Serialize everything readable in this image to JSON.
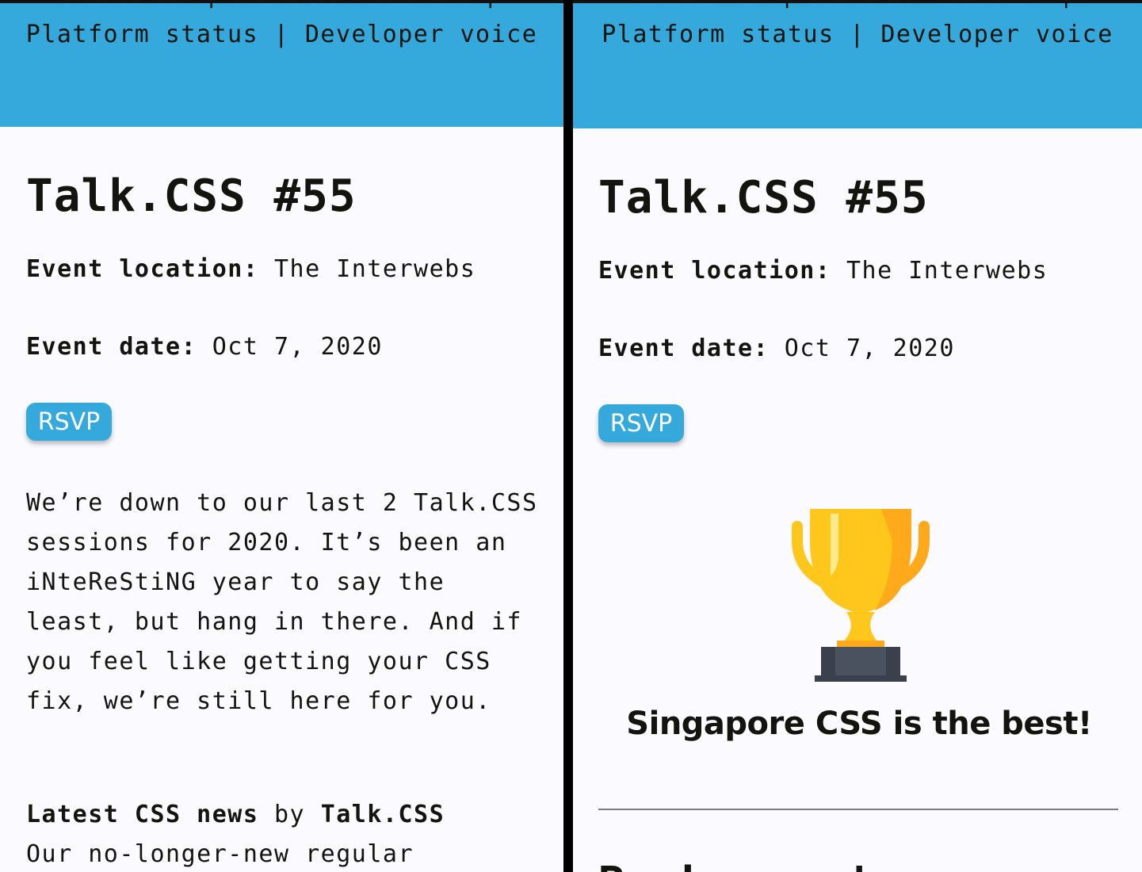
{
  "nav": {
    "top_partial": "About us | Code of conduct |",
    "second_line": "Platform status | Developer voice"
  },
  "event": {
    "title": "Talk.CSS #55",
    "location_label": "Event location:",
    "location_value": "The Interwebs",
    "date_label": "Event date:",
    "date_value": "Oct 7, 2020",
    "rsvp_label": "RSVP"
  },
  "left": {
    "paragraph": "We’re down to our last 2 Talk.CSS sessions for 2020. It’s been an iNteReStiNG year to say the least, but hang in there. And if you feel like getting your CSS fix, we’re still here for you.",
    "news_title": "Latest CSS news",
    "news_by": "by",
    "news_author": "Talk.CSS",
    "news_body": "Our no-longer-new regular"
  },
  "right": {
    "trophy_icon": "trophy-icon",
    "caption": "Singapore CSS is the best!",
    "cut_heading": "Back soon!"
  },
  "colors": {
    "header": "#35a8dc",
    "trophy_gold": "#ffc61b",
    "trophy_base": "#4a5260"
  }
}
